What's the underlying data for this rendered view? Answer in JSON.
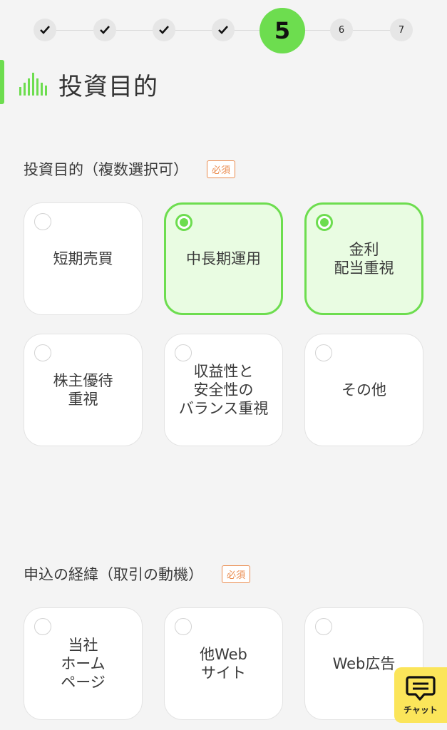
{
  "stepper": {
    "steps": [
      {
        "label": "",
        "state": "done"
      },
      {
        "label": "",
        "state": "done"
      },
      {
        "label": "",
        "state": "done"
      },
      {
        "label": "",
        "state": "done"
      },
      {
        "label": "5",
        "state": "current"
      },
      {
        "label": "6",
        "state": "todo"
      },
      {
        "label": "7",
        "state": "todo"
      }
    ]
  },
  "header": {
    "title": "投資目的"
  },
  "questions": [
    {
      "label": "投資目的（複数選択可）",
      "required_label": "必須",
      "options": [
        {
          "label": "短期売買",
          "selected": false
        },
        {
          "label": "中長期運用",
          "selected": true
        },
        {
          "label": "金利\n配当重視",
          "selected": true
        },
        {
          "label": "株主優待\n重視",
          "selected": false
        },
        {
          "label": "収益性と\n安全性の\nバランス重視",
          "selected": false
        },
        {
          "label": "その他",
          "selected": false
        }
      ]
    },
    {
      "label": "申込の経緯（取引の動機）",
      "required_label": "必須",
      "options": [
        {
          "label": "当社\nホーム\nページ",
          "selected": false
        },
        {
          "label": "他Web\nサイト",
          "selected": false
        },
        {
          "label": "Web広告",
          "selected": false
        }
      ]
    }
  ],
  "chat": {
    "label": "チャット"
  },
  "colors": {
    "accent": "#6ddd4f",
    "required": "#ea8a4c",
    "chat_bg": "#fbe55a"
  }
}
